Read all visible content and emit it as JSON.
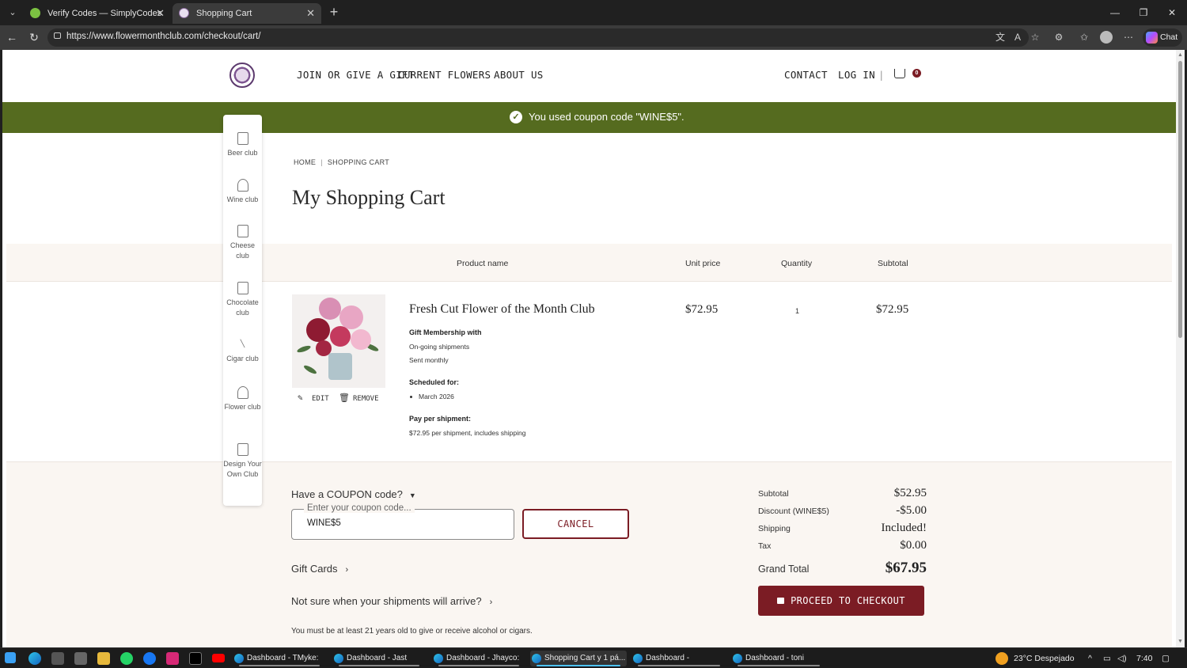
{
  "browser": {
    "tabs": [
      {
        "title": "Verify Codes — SimplyCodes",
        "active": false
      },
      {
        "title": "Shopping Cart",
        "active": true
      }
    ],
    "url": "https://www.flowermonthclub.com/checkout/cart/",
    "chat_label": "Chat"
  },
  "header": {
    "nav": [
      "JOIN OR GIVE A GIFT",
      "CURRENT FLOWERS",
      "ABOUT US"
    ],
    "contact": "CONTACT",
    "login": "LOG IN",
    "divider": "|",
    "cart_count": "0"
  },
  "notice": {
    "message": "You used coupon code \"WINE$5\"."
  },
  "clubs": [
    {
      "label": "Beer club",
      "icon": "beer-mug-icon"
    },
    {
      "label": "Wine club",
      "icon": "wine-glass-icon"
    },
    {
      "label": "Cheese club",
      "icon": "cheese-icon"
    },
    {
      "label": "Chocolate club",
      "icon": "chocolate-icon"
    },
    {
      "label": "Cigar club",
      "icon": "cigar-icon"
    },
    {
      "label": "Flower club",
      "icon": "flower-icon"
    },
    {
      "label": "Design Your Own Club",
      "icon": "design-icon"
    }
  ],
  "breadcrumb": {
    "home": "HOME",
    "current": "SHOPPING CART",
    "sep": "|"
  },
  "page_title": "My Shopping Cart",
  "table": {
    "headers": {
      "product": "Product name",
      "unit": "Unit price",
      "qty": "Quantity",
      "subtotal": "Subtotal"
    }
  },
  "item": {
    "name": "Fresh Cut Flower of the Month Club",
    "option_heading": "Gift Membership with",
    "option_lines": [
      "On-going shipments",
      "Sent monthly"
    ],
    "scheduled_heading": "Scheduled for:",
    "scheduled_value": "March 2026",
    "pay_heading": "Pay per shipment:",
    "pay_value": "$72.95 per shipment, includes shipping",
    "unit_price": "$72.95",
    "quantity": "1",
    "subtotal": "$72.95",
    "edit_label": "EDIT",
    "remove_label": "REMOVE"
  },
  "coupon": {
    "toggle_label": "Have a COUPON code?",
    "placeholder": "Enter your coupon code...",
    "value": "WINE$5",
    "cancel_label": "CANCEL"
  },
  "links": {
    "gift_cards": "Gift Cards",
    "shipments": "Not sure when your shipments will arrive?"
  },
  "age_note": "You must be at least 21 years old to give or receive alcohol or cigars.",
  "summary": {
    "rows": [
      {
        "label": "Subtotal",
        "value": "$52.95"
      },
      {
        "label": "Discount (WINE$5)",
        "value": "-$5.00"
      },
      {
        "label": "Shipping",
        "value": "Included!"
      },
      {
        "label": "Tax",
        "value": "$0.00"
      }
    ],
    "grand_label": "Grand Total",
    "grand_value": "$67.95",
    "checkout_label": "PROCEED TO CHECKOUT"
  },
  "taskbar": {
    "tasks": [
      {
        "label": "Dashboard - TMyke: ...",
        "active": false
      },
      {
        "label": "Dashboard - Jast Carl...",
        "active": false
      },
      {
        "label": "Dashboard - Jhayco: ...",
        "active": false
      },
      {
        "label": "Shopping Cart y 1 pá...",
        "active": true
      },
      {
        "label": "Dashboard - Pequeño...",
        "active": false
      },
      {
        "label": "Dashboard - toni kros...",
        "active": false
      }
    ],
    "weather": "23°C Despejado",
    "time": "7:40"
  },
  "colors": {
    "brand_maroon": "#7b1c24",
    "notice_green": "#556b1f",
    "summary_bg": "#faf6f2"
  }
}
